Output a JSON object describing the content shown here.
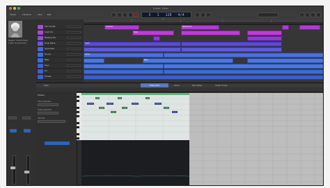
{
  "window": {
    "title": "Untitled - Tracks"
  },
  "toolbar": {
    "lcd": {
      "bar": "3",
      "beat": "1",
      "tempo": "120",
      "signature": "4/4",
      "key": "Cmaj"
    },
    "labels": {
      "library": "Library",
      "functions": "Functions",
      "view": "View",
      "edit": "Edit"
    }
  },
  "inspector": {
    "region_label": "Region: Sound Asset",
    "track_label": "Track: Sound Asset"
  },
  "tracks": [
    {
      "name": "Intro Vocals",
      "color": "#a34ed1"
    },
    {
      "name": "Lead Vox",
      "color": "#a34ed1"
    },
    {
      "name": "Backing Vox",
      "color": "#8a52d6"
    },
    {
      "name": "Hook Stack",
      "color": "#6b58d9"
    },
    {
      "name": "Synth Pad",
      "color": "#4a66dd"
    },
    {
      "name": "Drums",
      "color": "#3b6fe0"
    },
    {
      "name": "Bass",
      "color": "#3b6fe0"
    },
    {
      "name": "Keys",
      "color": "#3a62d6"
    },
    {
      "name": "FX",
      "color": "#3a62d6"
    },
    {
      "name": "Chords",
      "color": "#3a62d6"
    }
  ],
  "arrange": {
    "ruler_labels": [
      "Intro",
      "Verse",
      "Chorus",
      "Verse",
      "Chorus"
    ],
    "region_text": [
      "Lead Vox",
      "Backing Vox",
      "Hook",
      "Synth",
      "Drums",
      "Bass"
    ]
  },
  "editor": {
    "tabs": [
      "Track",
      "Piano Roll",
      "Score",
      "Step Editor",
      "Smart Tempo"
    ],
    "active_tab": "Piano Roll",
    "region_name": "Chords",
    "inspector_labels": [
      "Time Quantize",
      "Scale Quantize",
      "Velocity"
    ]
  },
  "colors": {
    "accent": "#5c79b8",
    "region_purple": "#b13ad6",
    "region_blue": "#4a78e3",
    "note_green": "#5fb37c",
    "note_blue": "#5d6fd4"
  }
}
